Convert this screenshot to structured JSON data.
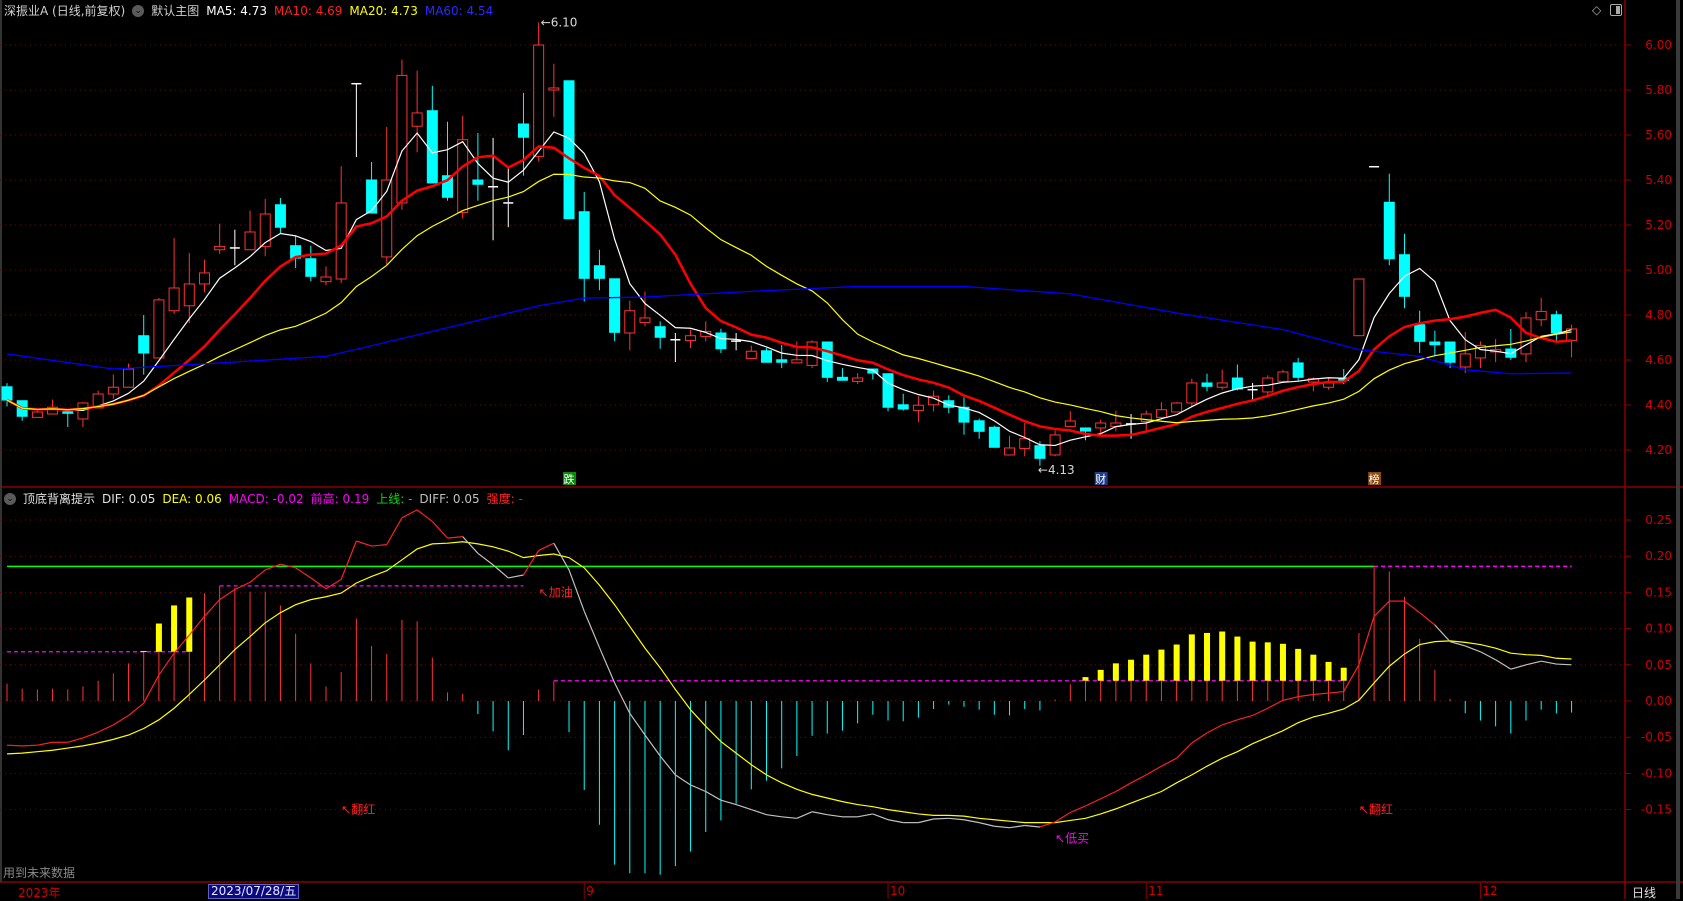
{
  "header": {
    "title": "深振业A (日线,前复权)",
    "main_chart": "默认主图",
    "ma5": "MA5: 4.73",
    "ma10": "MA10: 4.69",
    "ma20": "MA20: 4.73",
    "ma60": "MA60: 4.54"
  },
  "macd_header": {
    "name": "顶底背离提示",
    "dif": "DIF: 0.05",
    "dea": "DEA: 0.06",
    "macd": "MACD: -0.02",
    "prev_high": "前高: 0.19",
    "upper": "上线: -",
    "diff": "DIFF: 0.05",
    "strength": "强度: -"
  },
  "footer": {
    "future_data": "用到未来数据",
    "year": "2023年",
    "selected_date": "2023/07/28/五",
    "months": [
      {
        "label": "9",
        "index": 38
      },
      {
        "label": "10",
        "index": 58
      },
      {
        "label": "11",
        "index": 75
      },
      {
        "label": "12",
        "index": 97
      }
    ],
    "period": "日线"
  },
  "colors": {
    "up": "#ff3232",
    "down": "#00ffff",
    "doji": "#ffffff",
    "ma5": "#ffffff",
    "ma10": "#ff0000",
    "ma20": "#ffff00",
    "ma60": "#0000ff",
    "axis": "#d00000",
    "grid": "#7a0000",
    "dea": "#ffff00",
    "dif_up": "#ff2020",
    "dif_down": "#c0c0c0",
    "upper_line": "#00ff00",
    "dash": "#ff00ff",
    "hl": "#ffff00"
  },
  "chart_data": [
    {
      "type": "candlestick",
      "title": "深振业A (日线,前复权)",
      "ylim": [
        4.1,
        6.1
      ],
      "yticks": [
        "6.00",
        "5.80",
        "5.60",
        "5.40",
        "5.20",
        "5.00",
        "4.80",
        "4.60",
        "4.40",
        "4.20"
      ],
      "ohlc": [
        [
          4.481,
          4.497,
          4.394,
          4.422
        ],
        [
          4.419,
          4.419,
          4.33,
          4.35
        ],
        [
          4.345,
          4.384,
          4.345,
          4.369
        ],
        [
          4.36,
          4.424,
          4.36,
          4.39
        ],
        [
          4.37,
          4.37,
          4.302,
          4.363
        ],
        [
          4.338,
          4.413,
          4.302,
          4.409
        ],
        [
          4.387,
          4.464,
          4.387,
          4.449
        ],
        [
          4.449,
          4.535,
          4.427,
          4.479
        ],
        [
          4.479,
          4.584,
          4.479,
          4.56
        ],
        [
          4.708,
          4.8,
          4.535,
          4.631
        ],
        [
          4.609,
          4.876,
          4.609,
          4.867
        ],
        [
          4.819,
          5.142,
          4.804,
          4.92
        ],
        [
          4.841,
          5.076,
          4.764,
          4.938
        ],
        [
          4.938,
          5.046,
          4.901,
          4.987
        ],
        [
          5.09,
          5.206,
          5.071,
          5.105
        ],
        [
          5.098,
          5.179,
          5.021,
          5.098
        ],
        [
          5.09,
          5.264,
          5.09,
          5.169
        ],
        [
          5.105,
          5.316,
          5.061,
          5.249
        ],
        [
          5.29,
          5.32,
          5.164,
          5.19
        ],
        [
          5.108,
          5.15,
          5.009,
          5.053
        ],
        [
          5.05,
          5.108,
          4.95,
          4.972
        ],
        [
          4.948,
          5.016,
          4.932,
          4.969
        ],
        [
          4.96,
          5.461,
          4.942,
          5.298
        ],
        [
          5.828,
          5.828,
          5.502,
          5.828
        ],
        [
          5.4,
          5.48,
          5.253,
          5.253
        ],
        [
          5.058,
          5.636,
          5.024,
          5.4
        ],
        [
          5.298,
          5.935,
          5.268,
          5.865
        ],
        [
          5.639,
          5.886,
          5.523,
          5.698
        ],
        [
          5.708,
          5.819,
          5.387,
          5.387
        ],
        [
          5.419,
          5.659,
          5.308,
          5.323
        ],
        [
          5.256,
          5.686,
          5.228,
          5.579
        ],
        [
          5.4,
          5.609,
          5.308,
          5.381
        ],
        [
          5.37,
          5.587,
          5.132,
          5.37
        ],
        [
          5.298,
          5.453,
          5.19,
          5.298
        ],
        [
          5.649,
          5.787,
          5.419,
          5.59
        ],
        [
          5.505,
          6.1,
          5.483,
          6.0
        ],
        [
          5.8,
          5.917,
          5.681,
          5.809
        ],
        [
          5.841,
          5.841,
          5.228,
          5.228
        ],
        [
          5.259,
          5.347,
          4.861,
          4.963
        ],
        [
          5.019,
          5.09,
          4.91,
          4.963
        ],
        [
          4.961,
          4.961,
          4.683,
          4.723
        ],
        [
          4.72,
          4.864,
          4.643,
          4.819
        ],
        [
          4.767,
          4.904,
          4.75,
          4.787
        ],
        [
          4.748,
          4.772,
          4.65,
          4.701
        ],
        [
          4.69,
          4.72,
          4.591,
          4.69
        ],
        [
          4.687,
          4.735,
          4.653,
          4.708
        ],
        [
          4.705,
          4.772,
          4.683,
          4.727
        ],
        [
          4.72,
          4.739,
          4.631,
          4.65
        ],
        [
          4.684,
          4.72,
          4.643,
          4.684
        ],
        [
          4.607,
          4.664,
          4.607,
          4.639
        ],
        [
          4.641,
          4.653,
          4.59,
          4.59
        ],
        [
          4.601,
          4.667,
          4.564,
          4.59
        ],
        [
          4.587,
          4.683,
          4.587,
          4.601
        ],
        [
          4.576,
          4.687,
          4.564,
          4.68
        ],
        [
          4.68,
          4.68,
          4.502,
          4.523
        ],
        [
          4.523,
          4.564,
          4.51,
          4.51
        ],
        [
          4.505,
          4.542,
          4.493,
          4.52
        ],
        [
          4.56,
          4.56,
          4.513,
          4.542
        ],
        [
          4.539,
          4.539,
          4.372,
          4.39
        ],
        [
          4.401,
          4.45,
          4.375,
          4.382
        ],
        [
          4.376,
          4.439,
          4.324,
          4.399
        ],
        [
          4.401,
          4.464,
          4.372,
          4.439
        ],
        [
          4.419,
          4.443,
          4.364,
          4.39
        ],
        [
          4.39,
          4.434,
          4.268,
          4.324
        ],
        [
          4.33,
          4.339,
          4.25,
          4.283
        ],
        [
          4.301,
          4.308,
          4.212,
          4.212
        ],
        [
          4.178,
          4.264,
          4.178,
          4.209
        ],
        [
          4.207,
          4.32,
          4.172,
          4.25
        ],
        [
          4.219,
          4.239,
          4.13,
          4.163
        ],
        [
          4.178,
          4.287,
          4.172,
          4.267
        ],
        [
          4.305,
          4.372,
          4.305,
          4.329
        ],
        [
          4.298,
          4.298,
          4.243,
          4.284
        ],
        [
          4.298,
          4.335,
          4.268,
          4.32
        ],
        [
          4.305,
          4.375,
          4.283,
          4.32
        ],
        [
          4.316,
          4.36,
          4.25,
          4.316
        ],
        [
          4.327,
          4.375,
          4.283,
          4.36
        ],
        [
          4.345,
          4.413,
          4.335,
          4.379
        ],
        [
          4.369,
          4.413,
          4.369,
          4.409
        ],
        [
          4.409,
          4.517,
          4.394,
          4.498
        ],
        [
          4.498,
          4.539,
          4.461,
          4.483
        ],
        [
          4.479,
          4.557,
          4.468,
          4.498
        ],
        [
          4.52,
          4.58,
          4.465,
          4.471
        ],
        [
          4.468,
          4.498,
          4.424,
          4.468
        ],
        [
          4.458,
          4.532,
          4.439,
          4.52
        ],
        [
          4.505,
          4.557,
          4.498,
          4.547
        ],
        [
          4.587,
          4.609,
          4.505,
          4.523
        ],
        [
          4.502,
          4.523,
          4.461,
          4.517
        ],
        [
          4.479,
          4.52,
          4.468,
          4.498
        ],
        [
          4.52,
          4.56,
          4.493,
          4.51
        ],
        [
          4.708,
          4.96,
          4.708,
          4.96
        ],
        [
          5.459,
          5.459,
          5.459,
          5.459
        ],
        [
          5.301,
          5.428,
          5.021,
          5.05
        ],
        [
          5.068,
          5.161,
          4.83,
          4.883
        ],
        [
          4.757,
          4.819,
          4.631,
          4.683
        ],
        [
          4.68,
          4.73,
          4.619,
          4.668
        ],
        [
          4.68,
          4.68,
          4.564,
          4.59
        ],
        [
          4.569,
          4.724,
          4.542,
          4.627
        ],
        [
          4.609,
          4.683,
          4.564,
          4.665
        ],
        [
          4.636,
          4.693,
          4.59,
          4.646
        ],
        [
          4.649,
          4.738,
          4.601,
          4.612
        ],
        [
          4.627,
          4.813,
          4.59,
          4.787
        ],
        [
          4.779,
          4.876,
          4.75,
          4.816
        ],
        [
          4.801,
          4.819,
          4.687,
          4.72
        ],
        [
          4.687,
          4.757,
          4.612,
          4.738
        ]
      ],
      "ma_periods": [
        5,
        10,
        20
      ],
      "ma60_points": [
        [
          0,
          4.627
        ],
        [
          7,
          4.56
        ],
        [
          14,
          4.587
        ],
        [
          21,
          4.616
        ],
        [
          28,
          4.727
        ],
        [
          35,
          4.841
        ],
        [
          38,
          4.875
        ],
        [
          42,
          4.88
        ],
        [
          49,
          4.905
        ],
        [
          56,
          4.927
        ],
        [
          63,
          4.927
        ],
        [
          70,
          4.894
        ],
        [
          77,
          4.809
        ],
        [
          84,
          4.735
        ],
        [
          89,
          4.646
        ],
        [
          93,
          4.616
        ],
        [
          96,
          4.557
        ],
        [
          99,
          4.539
        ],
        [
          103,
          4.542
        ]
      ],
      "high_label": {
        "index": 35,
        "value": 6.1,
        "text": "6.10"
      },
      "low_label": {
        "index": 68,
        "value": 4.13,
        "text": "4.13"
      },
      "markers": [
        {
          "index": 37,
          "text": "跌",
          "bg": "#0b8a0b"
        },
        {
          "index": 72,
          "text": "财",
          "bg": "#1d3d8a"
        },
        {
          "index": 90,
          "text": "榜",
          "bg": "#8a4a10"
        }
      ]
    },
    {
      "type": "macd",
      "title": "顶底背离提示",
      "ylim": [
        -0.25,
        0.28
      ],
      "yticks": [
        "0.25",
        "0.20",
        "0.15",
        "0.10",
        "0.05",
        "0.00",
        "-0.05",
        "-0.10",
        "-0.15"
      ],
      "histogram": [
        0.024,
        0.017,
        0.016,
        0.017,
        0.016,
        0.02,
        0.028,
        0.038,
        0.052,
        0.069,
        0.107,
        0.132,
        0.143,
        0.149,
        0.159,
        0.156,
        0.151,
        0.151,
        0.132,
        0.093,
        0.052,
        0.02,
        0.04,
        0.114,
        0.076,
        0.065,
        0.112,
        0.11,
        0.06,
        0.012,
        0.01,
        -0.018,
        -0.042,
        -0.068,
        -0.047,
        0.016,
        0.028,
        -0.043,
        -0.123,
        -0.171,
        -0.226,
        -0.238,
        -0.238,
        -0.24,
        -0.228,
        -0.208,
        -0.181,
        -0.165,
        -0.142,
        -0.122,
        -0.11,
        -0.093,
        -0.076,
        -0.048,
        -0.045,
        -0.041,
        -0.031,
        -0.019,
        -0.027,
        -0.028,
        -0.023,
        -0.011,
        -0.005,
        -0.008,
        -0.012,
        -0.019,
        -0.02,
        -0.011,
        -0.013,
        0.002,
        0.023,
        0.033,
        0.043,
        0.052,
        0.057,
        0.064,
        0.071,
        0.078,
        0.092,
        0.094,
        0.096,
        0.089,
        0.082,
        0.081,
        0.079,
        0.072,
        0.064,
        0.054,
        0.046,
        0.094,
        0.186,
        0.179,
        0.144,
        0.086,
        0.043,
        0.003,
        -0.017,
        -0.027,
        -0.035,
        -0.045,
        -0.027,
        -0.012,
        -0.017,
        -0.016
      ],
      "dif": [
        -0.061,
        -0.062,
        -0.061,
        -0.057,
        -0.057,
        -0.051,
        -0.043,
        -0.033,
        -0.02,
        -0.003,
        0.036,
        0.066,
        0.091,
        0.117,
        0.14,
        0.154,
        0.164,
        0.181,
        0.189,
        0.184,
        0.17,
        0.155,
        0.168,
        0.221,
        0.214,
        0.216,
        0.253,
        0.264,
        0.248,
        0.225,
        0.227,
        0.204,
        0.188,
        0.17,
        0.174,
        0.208,
        0.218,
        0.181,
        0.124,
        0.074,
        0.025,
        -0.017,
        -0.047,
        -0.076,
        -0.102,
        -0.116,
        -0.125,
        -0.137,
        -0.143,
        -0.15,
        -0.157,
        -0.16,
        -0.162,
        -0.153,
        -0.157,
        -0.16,
        -0.16,
        -0.156,
        -0.164,
        -0.168,
        -0.168,
        -0.163,
        -0.162,
        -0.164,
        -0.168,
        -0.173,
        -0.175,
        -0.172,
        -0.174,
        -0.167,
        -0.154,
        -0.145,
        -0.135,
        -0.125,
        -0.113,
        -0.102,
        -0.09,
        -0.079,
        -0.058,
        -0.044,
        -0.033,
        -0.026,
        -0.02,
        -0.01,
        0.001,
        0.006,
        0.009,
        0.011,
        0.013,
        0.05,
        0.117,
        0.138,
        0.138,
        0.122,
        0.105,
        0.082,
        0.076,
        0.068,
        0.057,
        0.044,
        0.05,
        0.055,
        0.051,
        0.05
      ],
      "dea": [
        -0.073,
        -0.072,
        -0.07,
        -0.068,
        -0.065,
        -0.062,
        -0.058,
        -0.053,
        -0.047,
        -0.038,
        -0.026,
        -0.01,
        0.009,
        0.029,
        0.05,
        0.071,
        0.089,
        0.108,
        0.122,
        0.133,
        0.14,
        0.144,
        0.149,
        0.163,
        0.172,
        0.18,
        0.195,
        0.21,
        0.217,
        0.218,
        0.22,
        0.217,
        0.213,
        0.207,
        0.198,
        0.201,
        0.203,
        0.198,
        0.184,
        0.16,
        0.133,
        0.103,
        0.073,
        0.046,
        0.016,
        -0.012,
        -0.035,
        -0.056,
        -0.072,
        -0.088,
        -0.102,
        -0.113,
        -0.122,
        -0.129,
        -0.134,
        -0.139,
        -0.143,
        -0.146,
        -0.15,
        -0.153,
        -0.156,
        -0.158,
        -0.158,
        -0.159,
        -0.162,
        -0.164,
        -0.166,
        -0.168,
        -0.168,
        -0.168,
        -0.165,
        -0.162,
        -0.156,
        -0.149,
        -0.141,
        -0.133,
        -0.125,
        -0.113,
        -0.102,
        -0.09,
        -0.079,
        -0.07,
        -0.059,
        -0.05,
        -0.041,
        -0.03,
        -0.022,
        -0.017,
        -0.011,
        0.001,
        0.025,
        0.048,
        0.065,
        0.078,
        0.082,
        0.083,
        0.081,
        0.078,
        0.073,
        0.066,
        0.064,
        0.063,
        0.059,
        0.058
      ],
      "upper_line": {
        "value": 0.186,
        "from": 0,
        "to": 90
      },
      "prev_high_segments": [
        {
          "from": 0,
          "to": 12,
          "value": 0.068
        },
        {
          "from": 14,
          "to": 34,
          "value": 0.159
        },
        {
          "from": 36,
          "to": 88,
          "value": 0.028
        },
        {
          "from": 90,
          "to": 103,
          "value": 0.186
        }
      ],
      "highlight_bars": [
        9,
        10,
        11,
        12,
        71,
        72,
        73,
        74,
        75,
        76,
        77,
        78,
        79,
        80,
        81,
        82,
        83,
        84,
        85,
        86,
        87,
        88
      ],
      "signals": [
        {
          "index": 22,
          "value": -0.15,
          "text": "↖翻红",
          "color": "#ff2020"
        },
        {
          "index": 35,
          "value": 0.15,
          "text": "↖加油",
          "color": "#ff2020"
        },
        {
          "index": 69,
          "value": -0.19,
          "text": "↖低买",
          "color": "#ff00ff"
        },
        {
          "index": 89,
          "value": -0.15,
          "text": "↖翻红",
          "color": "#ff2020"
        }
      ]
    }
  ]
}
